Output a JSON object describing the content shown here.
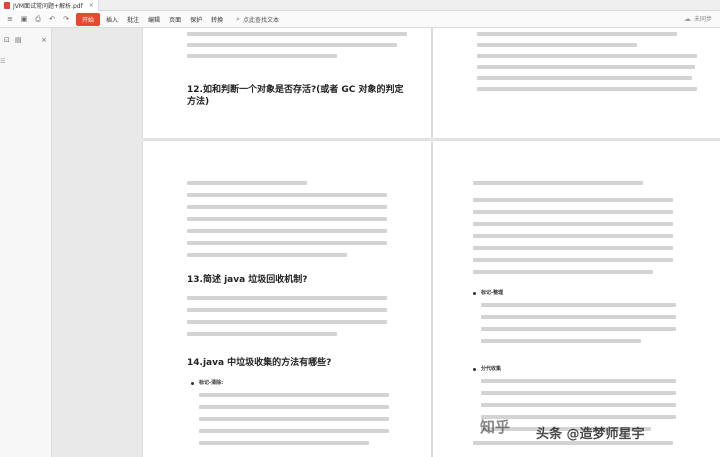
{
  "tab": {
    "title": "JVM面试常问题+解析.pdf",
    "close": "×"
  },
  "menu": {
    "start": "开始",
    "items": [
      "插入",
      "批注",
      "编辑",
      "页面",
      "保护",
      "转换"
    ],
    "search_placeholder": "点此查找文本",
    "sync_status": "未同步"
  },
  "pages": {
    "top_left_heading": "12.如和判断一个对象是否存活?(或者 GC 对象的判定方法)",
    "bottom_left_heading_13": "13.简述 java 垃圾回收机制?",
    "bottom_left_heading_14": "14.java 中垃圾收集的方法有哪些?",
    "bottom_left_list_1": "标记-清除:",
    "bottom_right_list_1": "标记-整理",
    "bottom_right_list_2": "分代收集"
  },
  "watermark": {
    "zhihu": "知乎",
    "toutiao": "头条 @造梦师星宇"
  },
  "colors": {
    "accent": "#e64a2e"
  }
}
